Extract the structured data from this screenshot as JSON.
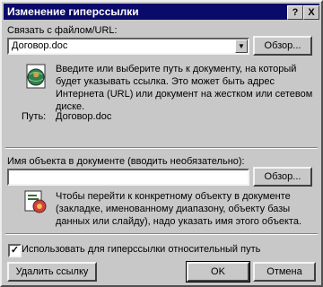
{
  "window": {
    "title": "Изменение гиперссылки",
    "help_label": "?",
    "close_label": "X"
  },
  "link_to": {
    "label": "Связать с файлом/URL:",
    "value": "Договор.doc",
    "browse_label": "Обзор...",
    "hint": "Введите или выберите путь к документу, на который будет указывать ссылка.  Это может быть адрес Интернета (URL) или документ на жестком или сетевом диске.",
    "path_label": "Путь:",
    "path_value": "Договор.doc"
  },
  "named_location": {
    "label": "Имя объекта в документе (вводить необязательно):",
    "value": "",
    "browse_label": "Обзор...",
    "hint": "Чтобы перейти к конкретному объекту в документе (закладке, именованному диапазону, объекту базы данных или слайду), надо указать имя этого объекта."
  },
  "relative_path": {
    "checked": true,
    "label": "Использовать для гиперссылки относительный путь"
  },
  "buttons": {
    "remove": "Удалить ссылку",
    "ok": "OK",
    "cancel": "Отмена"
  }
}
